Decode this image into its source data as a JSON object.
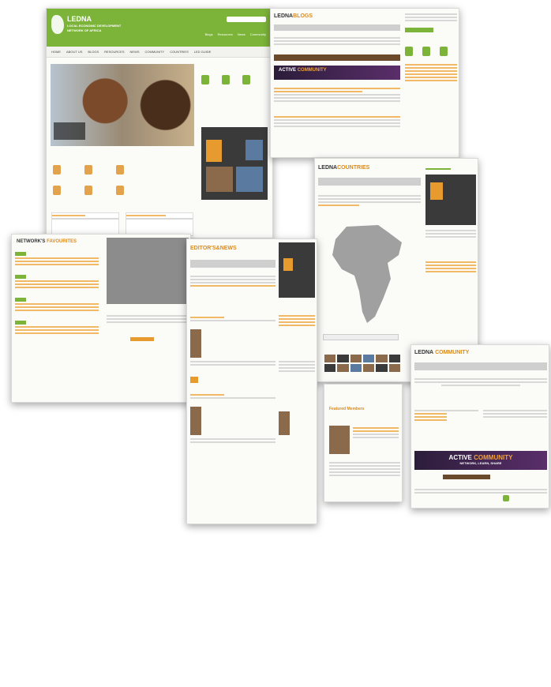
{
  "home": {
    "logo": "LEDNA",
    "tagline_1": "LOCAL ECONOMIC DEVELOPMENT",
    "tagline_2": "NETWORK OF AFRICA",
    "nav": [
      "HOME",
      "ABOUT US",
      "BLOGS",
      "RESOURCES",
      "NEWS",
      "COMMUNITY",
      "COUNTRIES",
      "LED GUIDE"
    ],
    "links": [
      "Blogs",
      "Resources",
      "News",
      "Community"
    ]
  },
  "blog": {
    "title_plain": "LEDNA",
    "title_accent": "BLOGS"
  },
  "countries": {
    "title_plain": "LEDNA",
    "title_accent": "COUNTRIES",
    "featured_label": "Featured Members"
  },
  "network": {
    "title_plain": "NETWORK'S",
    "title_accent": "FAVOURITES"
  },
  "news": {
    "title_plain": "EDITOR'S",
    "title_accent": "&NEWS"
  },
  "community": {
    "title_plain": "LEDNA",
    "title_accent": "COMMUNITY"
  },
  "banner": {
    "text_plain": "ACTIVE",
    "text_accent": "COMMUNITY",
    "sub": "NETWORK, LEARN, SHARE"
  },
  "colors": {
    "accent": "#e79a2d",
    "brand_green": "#7cb43a",
    "banner": "#2b1d3a"
  }
}
